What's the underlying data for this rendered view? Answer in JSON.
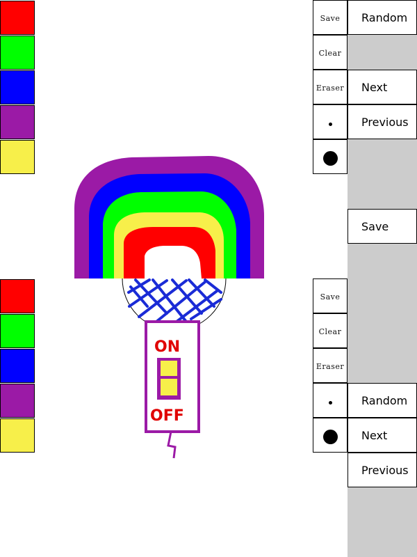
{
  "palette_top": [
    {
      "name": "red",
      "color": "#ff0000"
    },
    {
      "name": "green",
      "color": "#00ff00"
    },
    {
      "name": "blue",
      "color": "#0000ff"
    },
    {
      "name": "purple",
      "color": "#9b1aa6"
    },
    {
      "name": "yellow",
      "color": "#f7ef4a"
    }
  ],
  "palette_bottom": [
    {
      "name": "red",
      "color": "#ff0000"
    },
    {
      "name": "green",
      "color": "#00ff00"
    },
    {
      "name": "blue",
      "color": "#0000ff"
    },
    {
      "name": "purple",
      "color": "#9b1aa6"
    },
    {
      "name": "yellow",
      "color": "#f7ef4a"
    }
  ],
  "tools_top": {
    "save": "Save",
    "clear": "Clear",
    "eraser": "Eraser"
  },
  "tools_bottom": {
    "save": "Save",
    "clear": "Clear",
    "eraser": "Eraser"
  },
  "menu_top": {
    "random": "Random",
    "next": "Next",
    "previous": "Previous",
    "save": "Save"
  },
  "menu_bottom": {
    "random": "Random",
    "next": "Next",
    "previous": "Previous"
  },
  "drawing": {
    "on_text": "ON",
    "off_text": "OFF"
  },
  "colors": {
    "panel_gray": "#cccccc"
  }
}
